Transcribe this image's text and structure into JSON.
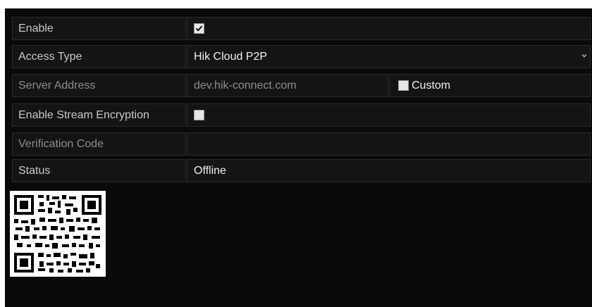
{
  "form": {
    "enable": {
      "label": "Enable",
      "checked": true
    },
    "access_type": {
      "label": "Access Type",
      "value": "Hik Cloud P2P"
    },
    "server_address": {
      "label": "Server Address",
      "value": "dev.hik-connect.com",
      "custom_label": "Custom",
      "custom_checked": false
    },
    "stream_encryption": {
      "label": "Enable Stream Encryption",
      "checked": false
    },
    "verification_code": {
      "label": "Verification Code",
      "value": ""
    },
    "status": {
      "label": "Status",
      "value": "Offline"
    }
  },
  "icons": {
    "dropdown": "chevron-down-icon",
    "qr": "qr-code-icon"
  },
  "colors": {
    "background": "#0a0a0a",
    "cell": "#141414",
    "text": "#f0f0f0",
    "label": "#c9c9c9",
    "disabled": "#8d8d8d"
  }
}
